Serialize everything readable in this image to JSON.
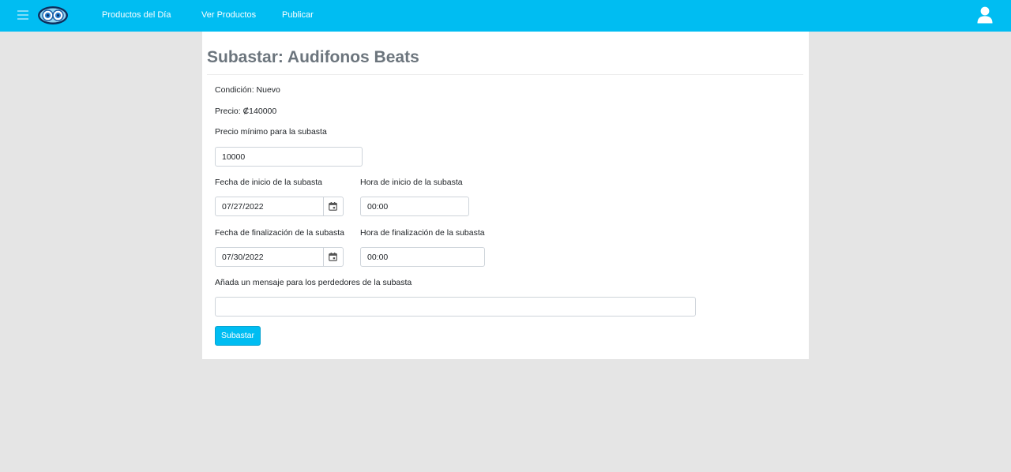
{
  "nav": {
    "links": [
      "Productos del Día",
      "Ver Productos",
      "Publicar"
    ],
    "brand_color": "#00bdf2"
  },
  "page": {
    "title": "Subastar: Audifonos Beats"
  },
  "details": {
    "condition": "Condición: Nuevo",
    "price": "Precio: ₡140000"
  },
  "form": {
    "min_price_label": "Precio mínimo para la subasta",
    "min_price_value": "10000",
    "start_date_label": "Fecha de inicio de la subasta",
    "start_date_value": "07/27/2022",
    "start_time_label": "Hora de inicio de la subasta",
    "start_time_value": "00:00",
    "end_date_label": "Fecha de finalización de la subasta",
    "end_date_value": "07/30/2022",
    "end_time_label": "Hora de finalización de la subasta",
    "end_time_value": "00:00",
    "message_label": "Añada un mensaje para los perdedores de la subasta",
    "message_value": "",
    "submit_label": "Subastar"
  },
  "icons": {
    "menu": "hamburger-icon",
    "logo": "logo-icon",
    "user": "user-icon",
    "calendar": "calendar-icon"
  }
}
